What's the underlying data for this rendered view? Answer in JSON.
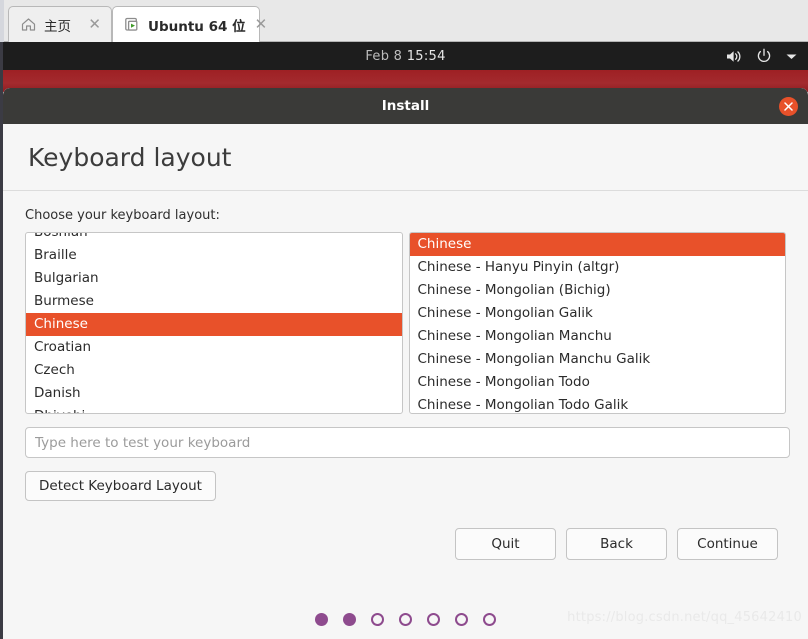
{
  "vm_tabs": [
    {
      "label": "主页",
      "icon": "home-icon",
      "close": "✕",
      "active": false
    },
    {
      "label": "Ubuntu 64 位",
      "icon": "vm-play-icon",
      "close": "✕",
      "active": true
    }
  ],
  "desktop": {
    "clock_date": "Feb 8",
    "clock_time": "15:54",
    "indicators": [
      "volume-icon",
      "power-icon",
      "chevron-down-icon"
    ]
  },
  "window": {
    "title": "Install",
    "close_label": "✕"
  },
  "page": {
    "heading": "Keyboard layout",
    "choose_label": "Choose your keyboard layout:"
  },
  "layout_list": {
    "items": [
      {
        "label": "Bosnian",
        "selected": false,
        "clipped": true
      },
      {
        "label": "Braille",
        "selected": false,
        "clipped": false
      },
      {
        "label": "Bulgarian",
        "selected": false,
        "clipped": false
      },
      {
        "label": "Burmese",
        "selected": false,
        "clipped": false
      },
      {
        "label": "Chinese",
        "selected": true,
        "clipped": false
      },
      {
        "label": "Croatian",
        "selected": false,
        "clipped": false
      },
      {
        "label": "Czech",
        "selected": false,
        "clipped": false
      },
      {
        "label": "Danish",
        "selected": false,
        "clipped": false
      },
      {
        "label": "Dhivehi",
        "selected": false,
        "clipped": true
      }
    ]
  },
  "variant_list": {
    "items": [
      {
        "label": "Chinese",
        "selected": true
      },
      {
        "label": "Chinese - Hanyu Pinyin (altgr)",
        "selected": false
      },
      {
        "label": "Chinese - Mongolian (Bichig)",
        "selected": false
      },
      {
        "label": "Chinese - Mongolian Galik",
        "selected": false
      },
      {
        "label": "Chinese - Mongolian Manchu",
        "selected": false
      },
      {
        "label": "Chinese - Mongolian Manchu Galik",
        "selected": false
      },
      {
        "label": "Chinese - Mongolian Todo",
        "selected": false
      },
      {
        "label": "Chinese - Mongolian Todo Galik",
        "selected": false
      }
    ]
  },
  "test_input": {
    "value": "",
    "placeholder": "Type here to test your keyboard"
  },
  "detect_button": {
    "label": "Detect Keyboard Layout"
  },
  "actions": {
    "quit": "Quit",
    "back": "Back",
    "continue": "Continue"
  },
  "progress_dots": {
    "total": 7,
    "filled": 2
  },
  "watermark": "https://blog.csdn.net/qq_45642410",
  "colors": {
    "ubuntu_orange": "#e8512a",
    "dot_purple": "#8e4b8e",
    "titlebar": "#3a3a38",
    "topbar": "#1d1d1d",
    "desktop_band": "#9e2024"
  }
}
